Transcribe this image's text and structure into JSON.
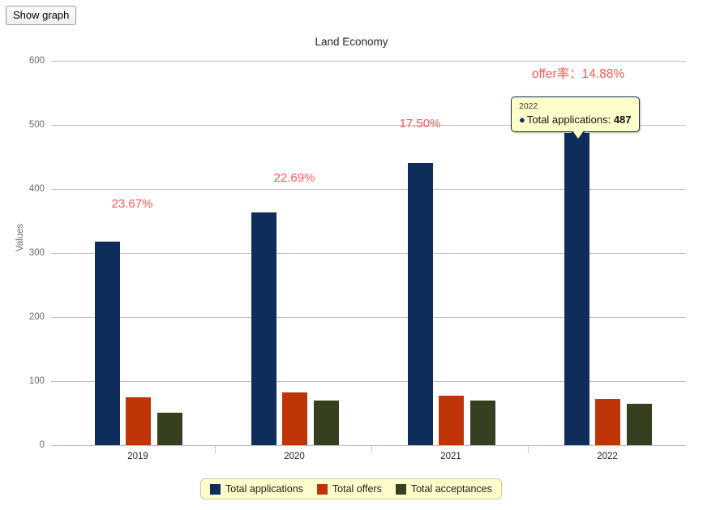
{
  "toolbar": {
    "show_graph_label": "Show graph"
  },
  "chart_data": {
    "type": "bar",
    "title": "Land Economy",
    "xlabel": "",
    "ylabel": "Values",
    "categories": [
      "2019",
      "2020",
      "2021",
      "2022"
    ],
    "series": [
      {
        "name": "Total applications",
        "color": "#0e2d5a",
        "values": [
          317,
          362,
          440,
          487
        ]
      },
      {
        "name": "Total offers",
        "color": "#bf3508",
        "values": [
          75,
          82,
          77,
          72
        ]
      },
      {
        "name": "Total acceptances",
        "color": "#36401f",
        "values": [
          51,
          70,
          70,
          65
        ]
      }
    ],
    "ylim": [
      0,
      600
    ],
    "yticks": [
      "600",
      "500",
      "400",
      "300",
      "200",
      "100",
      "0"
    ],
    "grid": true,
    "legend_position": "bottom",
    "annotations": [
      {
        "text": "23.67%",
        "category": "2019",
        "color": "#fc5757"
      },
      {
        "text": "22.69%",
        "category": "2020",
        "color": "#fc5757"
      },
      {
        "text": "17.50%",
        "category": "2021",
        "color": "#fc5757"
      },
      {
        "text": "offer率：14.88%",
        "category": "2022",
        "color": "#fc5757"
      }
    ]
  },
  "tooltip": {
    "title": "2022",
    "bullet": "●",
    "series_label": "Total applications: ",
    "value": "487"
  }
}
